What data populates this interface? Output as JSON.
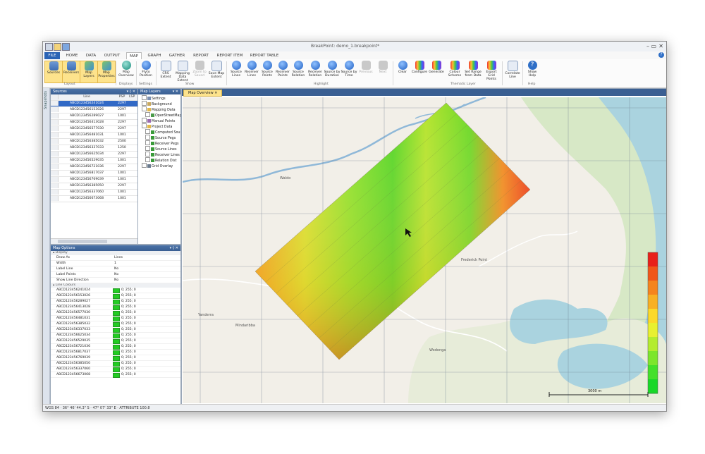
{
  "window": {
    "title": "BreakPoint: demo_1.breakpoint*",
    "controls": [
      "–",
      "▭",
      "✕"
    ]
  },
  "tabs": [
    "FILE",
    "HOME",
    "DATA",
    "OUTPUT",
    "MAP",
    "GRAPH",
    "GATHER",
    "REPORT",
    "REPORT ITEM",
    "REPORT TABLE"
  ],
  "ribbon": {
    "buttons": [
      {
        "label": "Sources",
        "icon": "sources-icon"
      },
      {
        "label": "Receivers",
        "icon": "receivers-icon"
      },
      {
        "label": "Map Layers",
        "icon": "map-layers-icon"
      },
      {
        "label": "Map Properties",
        "icon": "map-properties-icon"
      },
      {
        "label": "Map Overview",
        "icon": "globe-icon"
      },
      {
        "label": "Flyto Position",
        "icon": "flyto-icon"
      },
      {
        "label": "CRS Extent",
        "icon": "crs-icon"
      },
      {
        "label": "Mapping Data Extent",
        "icon": "mapping-extent-icon"
      },
      {
        "label": "Zoom to Saved",
        "icon": "zoom-saved-icon"
      },
      {
        "label": "Save Map Extent",
        "icon": "save-extent-icon"
      },
      {
        "label": "Source Lines",
        "icon": "search-icon"
      },
      {
        "label": "Receiver Lines",
        "icon": "search-icon"
      },
      {
        "label": "Source Points",
        "icon": "search-icon"
      },
      {
        "label": "Receiver Points",
        "icon": "search-icon"
      },
      {
        "label": "Source Relation",
        "icon": "search-icon"
      },
      {
        "label": "Receiver Relation",
        "icon": "search-icon"
      },
      {
        "label": "Source by Duration",
        "icon": "search-icon"
      },
      {
        "label": "Source by Time",
        "icon": "search-icon"
      },
      {
        "label": "Previous",
        "icon": "previous-icon"
      },
      {
        "label": "Next",
        "icon": "next-icon"
      },
      {
        "label": "Clear",
        "icon": "clear-icon"
      },
      {
        "label": "Configure",
        "icon": "configure-icon"
      },
      {
        "label": "Generate",
        "icon": "generate-icon"
      },
      {
        "label": "Colour Scheme",
        "icon": "colour-scheme-icon"
      },
      {
        "label": "Set Range from Data",
        "icon": "set-range-icon"
      },
      {
        "label": "Export Grid Points",
        "icon": "export-grid-icon"
      },
      {
        "label": "Correlate Line",
        "icon": "correlate-icon"
      },
      {
        "label": "Show Help",
        "icon": "help-icon"
      }
    ],
    "groups": [
      "Layout",
      "Displays",
      "Settings",
      "Show",
      "Highlight",
      "Thematic Layer",
      "Help"
    ]
  },
  "side_strip": "Snapshots",
  "sources_panel": {
    "title": "Sources",
    "columns": [
      "Line",
      "PSP",
      "LSP"
    ],
    "rows": [
      [
        "ABCD123456241024",
        "2297"
      ],
      [
        "ABCD123456153026",
        "2297"
      ],
      [
        "ABCD123456289027",
        "1001"
      ],
      [
        "ABCD123456413028",
        "2297"
      ],
      [
        "ABCD123456577030",
        "2297"
      ],
      [
        "ABCD123456481031",
        "1001"
      ],
      [
        "ABCD123456385032",
        "2500"
      ],
      [
        "ABCD123456337033",
        "1250"
      ],
      [
        "ABCD123456625034",
        "2297"
      ],
      [
        "ABCD123456529035",
        "1001"
      ],
      [
        "ABCD123456721036",
        "2297"
      ],
      [
        "ABCD123456817037",
        "1001"
      ],
      [
        "ABCD123456769039",
        "1001"
      ],
      [
        "ABCD123456385050",
        "2297"
      ],
      [
        "ABCD123456337060",
        "1001"
      ],
      [
        "ABCD123456673068",
        "1001"
      ]
    ]
  },
  "layers_panel": {
    "title": "Map Layers",
    "items": [
      "Settings",
      "Background",
      "Mapping Data",
      "OpenStreetMap",
      "Manual Points",
      "Project Data",
      "Computed Source",
      "Source Pegs",
      "Receiver Pegs",
      "Source Lines",
      "Receiver Lines",
      "Relation Dist",
      "Grid Overlay"
    ]
  },
  "map_options": {
    "title": "Map Options",
    "category1": "Display",
    "props": [
      {
        "k": "Draw As",
        "v": "Lines"
      },
      {
        "k": "Width",
        "v": "1"
      },
      {
        "k": "Label Line",
        "v": "No"
      },
      {
        "k": "Label Points",
        "v": "No"
      },
      {
        "k": "Show Line Direction",
        "v": "No"
      }
    ],
    "category2": "Line Colours",
    "colours": [
      "ABCD123456241024",
      "ABCD123456153026",
      "ABCD123456289027",
      "ABCD123456413028",
      "ABCD123456577030",
      "ABCD123456481031",
      "ABCD123456385032",
      "ABCD123456337033",
      "ABCD123456625034",
      "ABCD123456529035",
      "ABCD123456721036",
      "ABCD123456817037",
      "ABCD123456769039",
      "ABCD123456385050",
      "ABCD123456337060",
      "ABCD123456673068"
    ],
    "colour_value": "0; 255; 0"
  },
  "map_doc": {
    "tab": "Map Overview",
    "place_labels": [
      "Waldo",
      "Yanderra",
      "Mindaribba",
      "Frederick Point",
      "Wodonga"
    ],
    "scalebar": "3000 m",
    "legend_colors": [
      "#e8201a",
      "#f0561a",
      "#f5841e",
      "#f8b024",
      "#fbd92a",
      "#e8f030",
      "#b4ec2e",
      "#7de62c",
      "#43e02a",
      "#18d828"
    ]
  },
  "status": "WGS 84 · 36° 46' 44.3\" S · 47° 07' 33\" E · ATTRIBUTE 100.8"
}
